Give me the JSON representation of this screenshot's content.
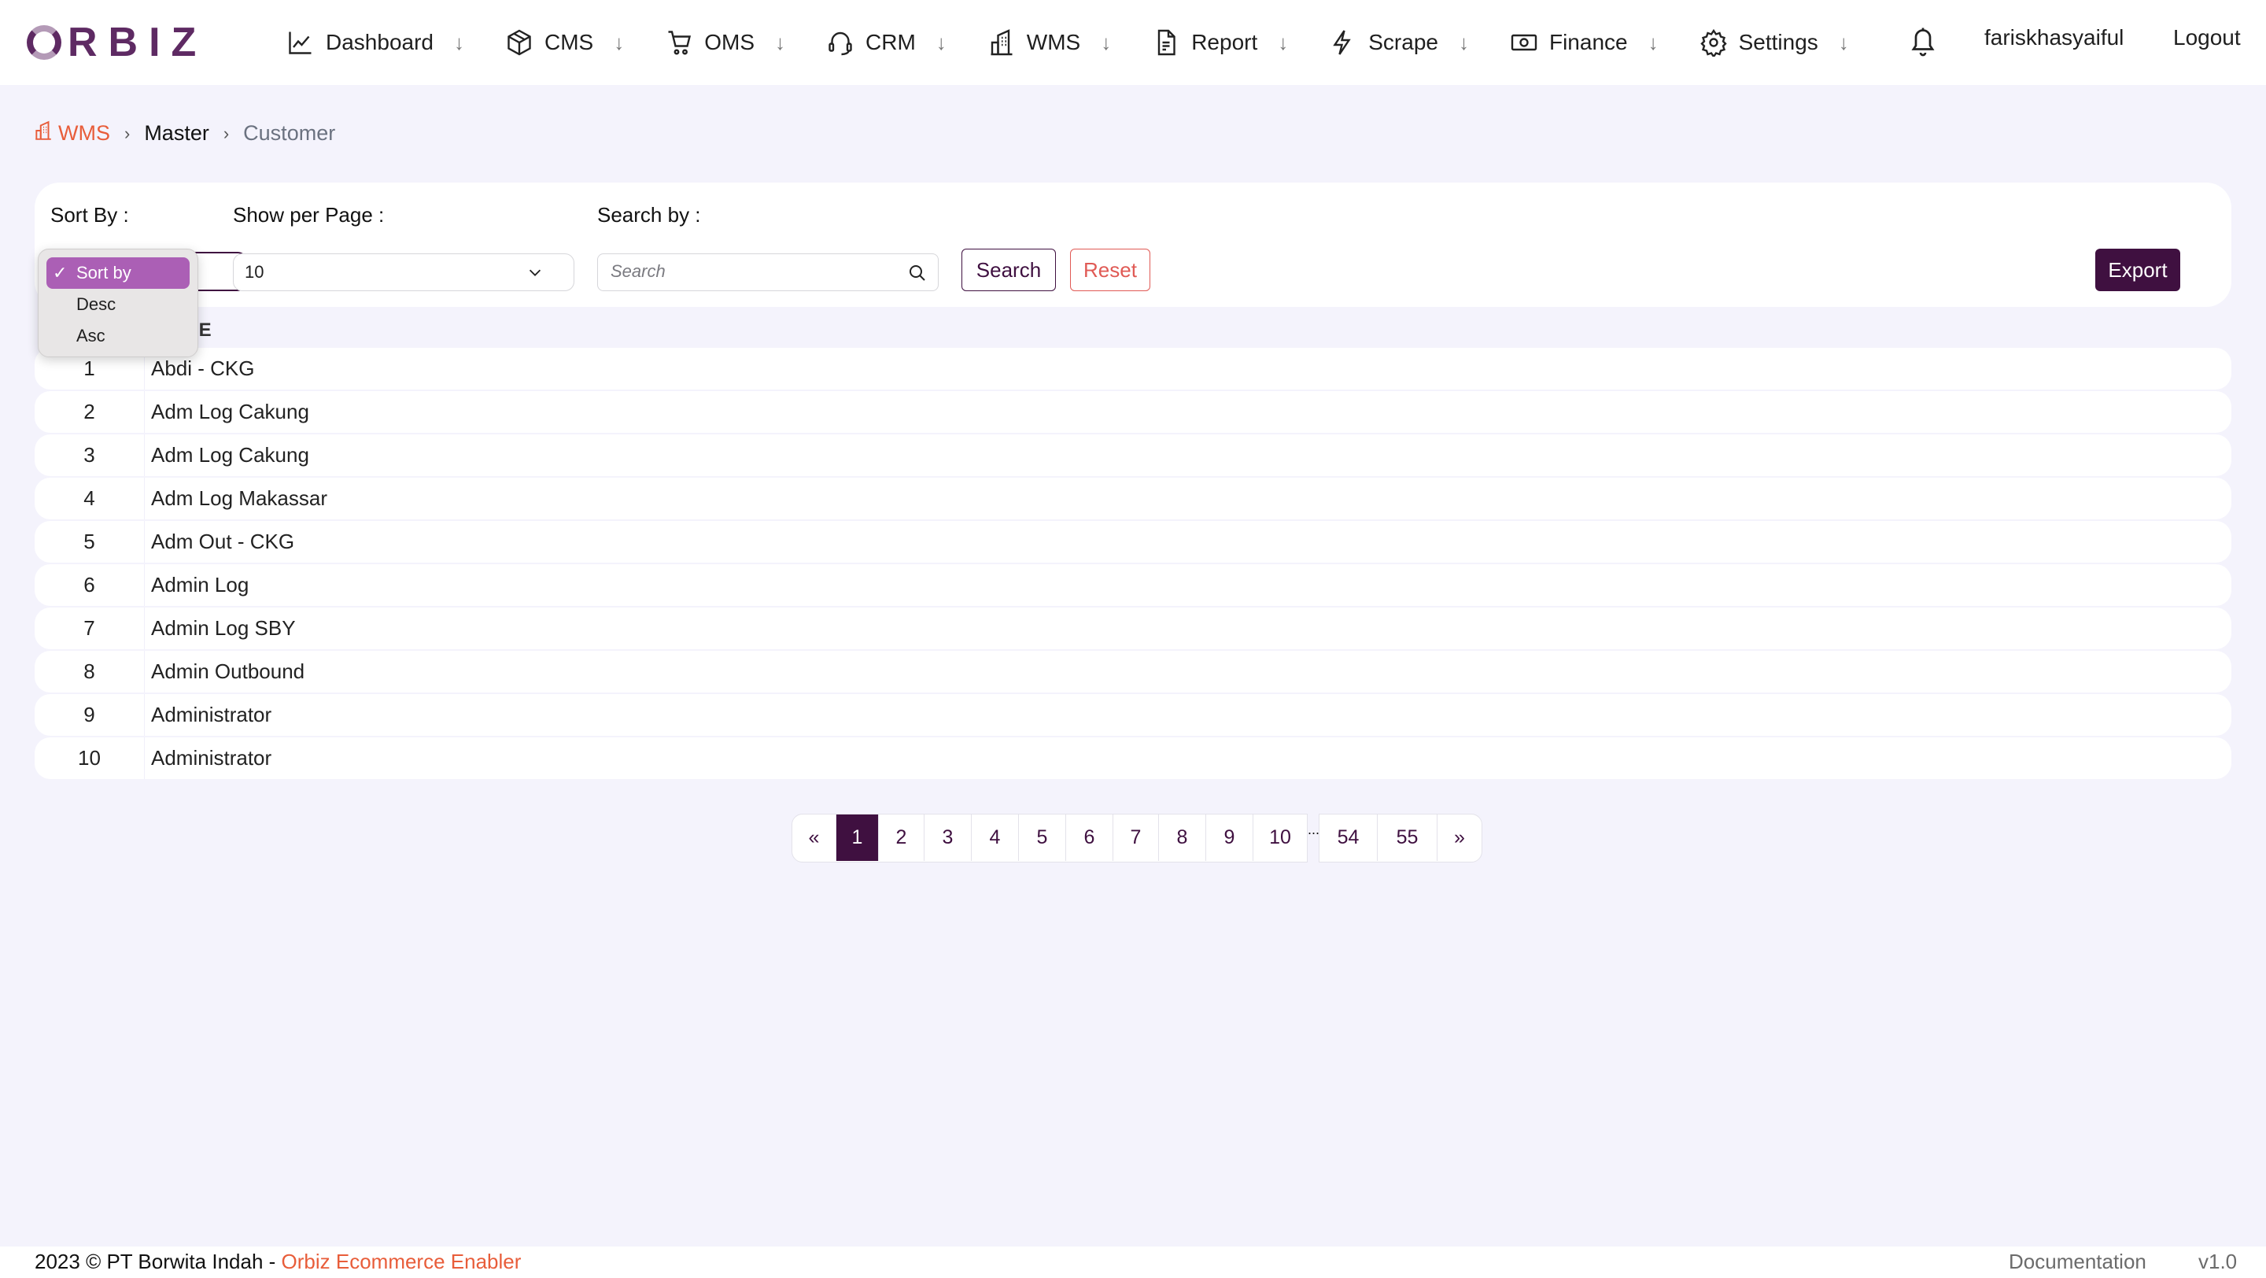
{
  "brand": {
    "logo_text": "RBIZ"
  },
  "nav": {
    "items": [
      {
        "label": "Dashboard",
        "icon": "chart-line-icon"
      },
      {
        "label": "CMS",
        "icon": "box-icon"
      },
      {
        "label": "OMS",
        "icon": "cart-icon"
      },
      {
        "label": "CRM",
        "icon": "headset-icon"
      },
      {
        "label": "WMS",
        "icon": "building-icon"
      },
      {
        "label": "Report",
        "icon": "document-icon"
      },
      {
        "label": "Scrape",
        "icon": "lightning-icon"
      },
      {
        "label": "Finance",
        "icon": "cash-icon"
      },
      {
        "label": "Settings",
        "icon": "gear-icon"
      }
    ],
    "arrow": "↓",
    "username": "fariskhasyaiful",
    "logout": "Logout"
  },
  "breadcrumb": {
    "root": "WMS",
    "sep": "›",
    "middle": "Master",
    "current": "Customer"
  },
  "filters": {
    "sort_label": "Sort By :",
    "perpage_label": "Show per Page :",
    "perpage_value": "10",
    "search_label": "Search by :",
    "search_placeholder": "Search",
    "search_value": "",
    "search_button": "Search",
    "reset_button": "Reset",
    "export_button": "Export"
  },
  "sort_dropdown": {
    "options": [
      "Sort by",
      "Desc",
      "Asc"
    ],
    "selected": "Sort by",
    "check": "✓"
  },
  "table": {
    "columns": [
      "",
      "NAME"
    ],
    "rows": [
      {
        "no": "1",
        "name": "Abdi - CKG"
      },
      {
        "no": "2",
        "name": "Adm Log Cakung"
      },
      {
        "no": "3",
        "name": "Adm Log Cakung"
      },
      {
        "no": "4",
        "name": "Adm Log Makassar"
      },
      {
        "no": "5",
        "name": "Adm Out - CKG"
      },
      {
        "no": "6",
        "name": "Admin Log"
      },
      {
        "no": "7",
        "name": "Admin Log SBY"
      },
      {
        "no": "8",
        "name": "Admin Outbound"
      },
      {
        "no": "9",
        "name": "Administrator"
      },
      {
        "no": "10",
        "name": "Administrator"
      }
    ]
  },
  "pagination": {
    "prev": "«",
    "pages_a": [
      "1",
      "2",
      "3",
      "4",
      "5",
      "6",
      "7",
      "8",
      "9",
      "10"
    ],
    "ellipsis": "...",
    "pages_b": [
      "54",
      "55"
    ],
    "next": "»",
    "current": "1"
  },
  "footer": {
    "copyright": "2023 © PT Borwita Indah - ",
    "brand_link": "Orbiz Ecommerce Enabler",
    "documentation": "Documentation",
    "version": "v1.0"
  },
  "colors": {
    "primary": "#3f1040",
    "accent": "#e85d3a",
    "reset": "#e05a55",
    "dropdown_selected": "#ab5fb5",
    "background": "#f4f3fc"
  }
}
